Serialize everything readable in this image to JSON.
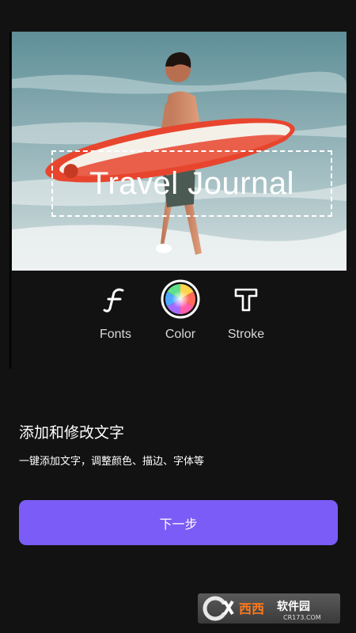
{
  "editor": {
    "overlay_text": "Travel Journal"
  },
  "tools": [
    {
      "label": "Fonts",
      "icon": "fonts-icon"
    },
    {
      "label": "Color",
      "icon": "color-wheel-icon"
    },
    {
      "label": "Stroke",
      "icon": "stroke-icon"
    }
  ],
  "info": {
    "title": "添加和修改文字",
    "subtitle": "一键添加文字，调整颜色、描边、字体等"
  },
  "next_button": {
    "label": "下一步"
  },
  "watermark": {
    "brand": "西西软件园",
    "url": "CR173.COM"
  },
  "colors": {
    "background": "#121212",
    "accent": "#7b5cf6"
  }
}
